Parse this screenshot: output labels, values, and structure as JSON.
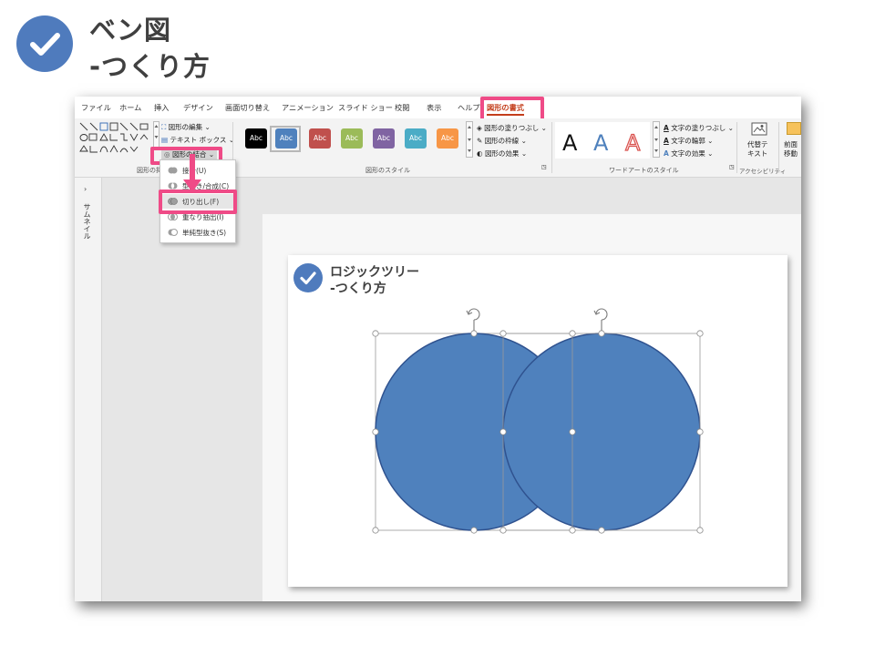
{
  "page_title": {
    "line1": "ベン図",
    "line2": "-つくり方"
  },
  "colors": {
    "accent_blue": "#4f7bbd",
    "highlight_pink": "#ef4b87",
    "shape_fill": "#4f81bd",
    "shape_stroke": "#2f528f",
    "active_tab": "#c43e1c"
  },
  "ribbon": {
    "tabs": [
      "ファイル",
      "ホーム",
      "挿入",
      "デザイン",
      "画面切り替え",
      "アニメーション",
      "スライド ショー",
      "校閲",
      "表示",
      "ヘルプ"
    ],
    "active_tab": "図形の書式",
    "insert_shapes": {
      "edit_shape": "図形の編集",
      "text_box": "テキスト ボックス",
      "merge_shapes": "図形の結合",
      "group_label": "図形の挿入"
    },
    "shape_styles": {
      "sample_text": "Abc",
      "swatches": [
        "#000000",
        "#4f81bd",
        "#c0504d",
        "#9bbb59",
        "#8064a2",
        "#4bacc6",
        "#f79646"
      ],
      "fill": "図形の塗りつぶし",
      "outline": "図形の枠線",
      "effects": "図形の効果",
      "group_label": "図形のスタイル"
    },
    "wordart": {
      "letter": "A",
      "text_fill": "文字の塗りつぶし",
      "text_outline": "文字の輪郭",
      "text_effects": "文字の効果",
      "group_label": "ワードアートのスタイル"
    },
    "accessibility": {
      "alt_text_line1": "代替テ",
      "alt_text_line2": "キスト",
      "group_label": "アクセシビリティ"
    },
    "arrange": {
      "line1": "前面",
      "line2": "移動"
    }
  },
  "merge_menu": {
    "items": [
      {
        "label": "接合(U)",
        "icon": "union-icon"
      },
      {
        "label": "型抜き/合成(C)",
        "icon": "combine-icon"
      },
      {
        "label": "切り出し(F)",
        "icon": "fragment-icon",
        "highlighted": true
      },
      {
        "label": "重なり抽出(I)",
        "icon": "intersect-icon"
      },
      {
        "label": "単純型抜き(S)",
        "icon": "subtract-icon"
      }
    ]
  },
  "thumbnail_pane": {
    "label": "サムネイル",
    "chevron": "›"
  },
  "slide": {
    "title1": "ロジックツリー",
    "title2": "-つくり方"
  }
}
